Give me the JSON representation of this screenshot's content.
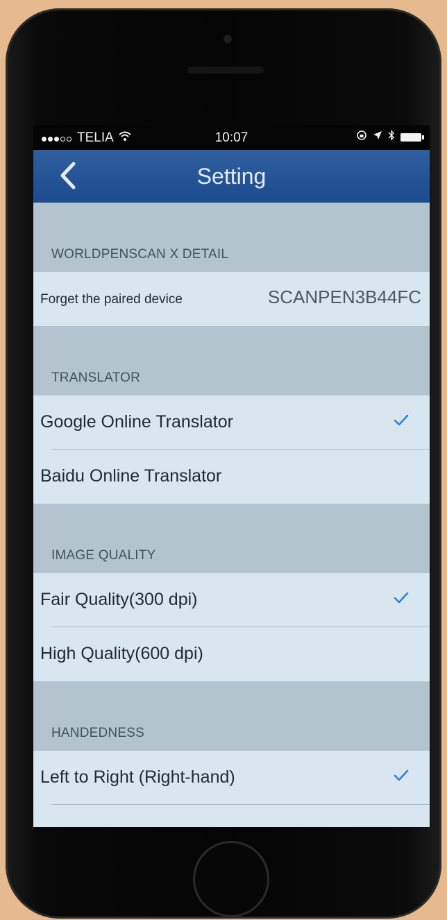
{
  "status_bar": {
    "carrier": "TELIA",
    "time": "10:07"
  },
  "nav": {
    "title": "Setting"
  },
  "sections": [
    {
      "header": "WORLDPENSCAN X DETAIL",
      "rows": [
        {
          "label": "Forget the paired device",
          "value": "SCANPEN3B44FC",
          "checked": false
        }
      ]
    },
    {
      "header": "TRANSLATOR",
      "rows": [
        {
          "label": "Google Online Translator",
          "checked": true
        },
        {
          "label": "Baidu Online Translator",
          "checked": false
        }
      ]
    },
    {
      "header": "IMAGE QUALITY",
      "rows": [
        {
          "label": "Fair Quality(300 dpi)",
          "checked": true
        },
        {
          "label": "High Quality(600 dpi)",
          "checked": false
        }
      ]
    },
    {
      "header": "HANDEDNESS",
      "rows": [
        {
          "label": "Left to Right (Right-hand)",
          "checked": true
        }
      ]
    }
  ],
  "colors": {
    "nav_bar": "#1c4b8f",
    "checkmark": "#2f7fe0",
    "section_header_bg": "#b3c4cf",
    "row_bg": "#d8e6ef"
  }
}
